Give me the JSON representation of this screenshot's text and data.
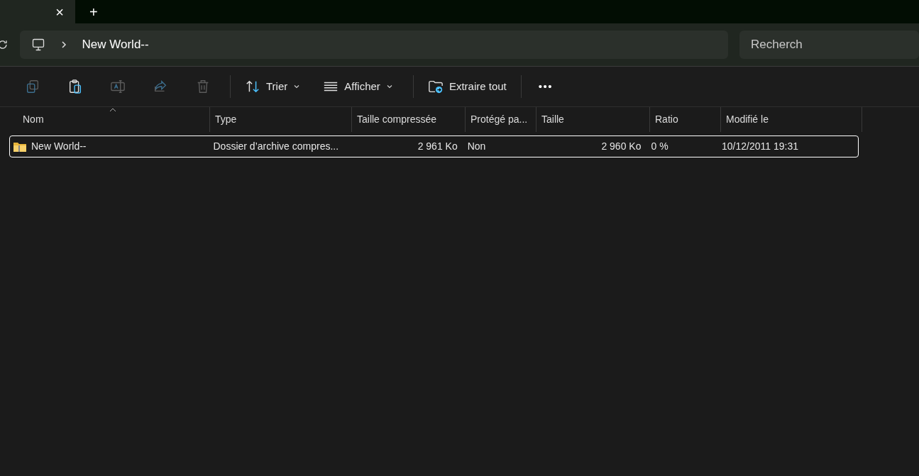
{
  "tab_bar": {
    "close": "×",
    "new_tab": "+"
  },
  "address_bar": {
    "path": "New World--",
    "search_placeholder": "Recherch"
  },
  "toolbar": {
    "icon_buttons": [
      {
        "kind": "copy",
        "disabled": true
      },
      {
        "kind": "paste",
        "disabled": false
      },
      {
        "kind": "rename",
        "disabled": true
      },
      {
        "kind": "share",
        "disabled": true
      },
      {
        "kind": "delete",
        "disabled": true
      }
    ],
    "menus": [
      {
        "kind": "sort",
        "label": "Trier"
      },
      {
        "kind": "view",
        "label": "Afficher"
      }
    ],
    "extract": {
      "label": "Extraire tout"
    },
    "more": "•••"
  },
  "table": {
    "columns": [
      "Nom",
      "Type",
      "Taille compressée",
      "Protégé pa...",
      "Taille",
      "Ratio",
      "Modifié le"
    ],
    "rows": [
      {
        "selected": true,
        "cells": [
          "New World--",
          "Dossier d’archive compres...",
          "2 961 Ko",
          "Non",
          "2 960 Ko",
          "0 %",
          "10/12/2011 19:31"
        ]
      }
    ]
  }
}
